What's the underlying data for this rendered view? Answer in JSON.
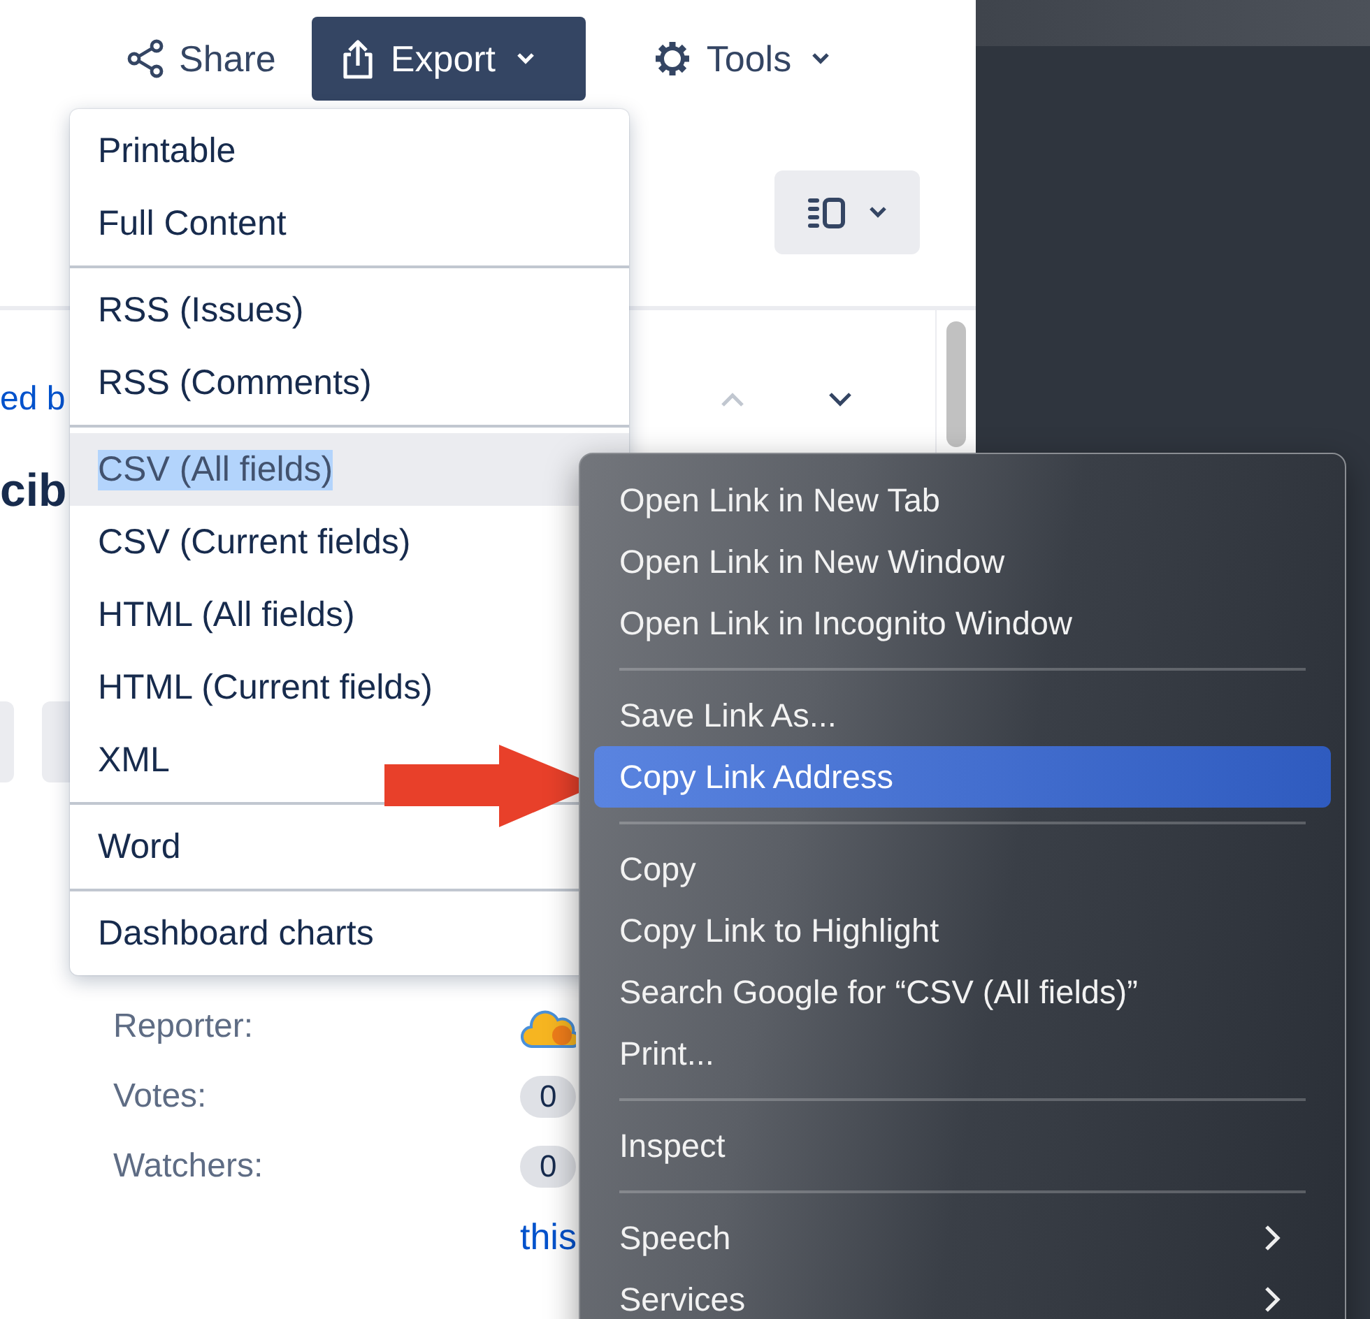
{
  "toolbar": {
    "share": {
      "label": "Share"
    },
    "export": {
      "label": "Export",
      "active": true
    },
    "tools": {
      "label": "Tools"
    }
  },
  "issue": {
    "link_fragment": "ed b",
    "title_fragment": "cib",
    "fields": [
      {
        "label": "Reporter:",
        "kind": "avatar"
      },
      {
        "label": "Votes:",
        "kind": "count",
        "value": "0"
      },
      {
        "label": "Watchers:",
        "kind": "count",
        "value": "0"
      }
    ],
    "link": "this"
  },
  "export_menu": {
    "groups": [
      {
        "items": [
          {
            "label": "Printable",
            "selected": false
          },
          {
            "label": "Full Content",
            "selected": false
          }
        ]
      },
      {
        "items": [
          {
            "label": "RSS (Issues)",
            "selected": false
          },
          {
            "label": "RSS (Comments)",
            "selected": false
          }
        ]
      },
      {
        "items": [
          {
            "label": "CSV (All fields)",
            "selected": true
          },
          {
            "label": "CSV (Current fields)",
            "selected": false
          },
          {
            "label": "HTML (All fields)",
            "selected": false
          },
          {
            "label": "HTML (Current fields)",
            "selected": false
          },
          {
            "label": "XML",
            "selected": false
          }
        ]
      },
      {
        "items": [
          {
            "label": "Word",
            "selected": false
          }
        ]
      },
      {
        "items": [
          {
            "label": "Dashboard charts",
            "selected": false
          }
        ]
      }
    ]
  },
  "context_menu": {
    "groups": [
      {
        "items": [
          {
            "label": "Open Link in New Tab",
            "selected": false,
            "submenu": false
          },
          {
            "label": "Open Link in New Window",
            "selected": false,
            "submenu": false
          },
          {
            "label": "Open Link in Incognito Window",
            "selected": false,
            "submenu": false
          }
        ]
      },
      {
        "items": [
          {
            "label": "Save Link As...",
            "selected": false,
            "submenu": false
          },
          {
            "label": "Copy Link Address",
            "selected": true,
            "submenu": false
          }
        ]
      },
      {
        "items": [
          {
            "label": "Copy",
            "selected": false,
            "submenu": false
          },
          {
            "label": "Copy Link to Highlight",
            "selected": false,
            "submenu": false
          },
          {
            "label": "Search Google for “CSV (All fields)”",
            "selected": false,
            "submenu": false
          },
          {
            "label": "Print...",
            "selected": false,
            "submenu": false
          }
        ]
      },
      {
        "items": [
          {
            "label": "Inspect",
            "selected": false,
            "submenu": false
          }
        ]
      },
      {
        "items": [
          {
            "label": "Speech",
            "selected": false,
            "submenu": true
          },
          {
            "label": "Services",
            "selected": false,
            "submenu": true
          }
        ]
      }
    ]
  }
}
